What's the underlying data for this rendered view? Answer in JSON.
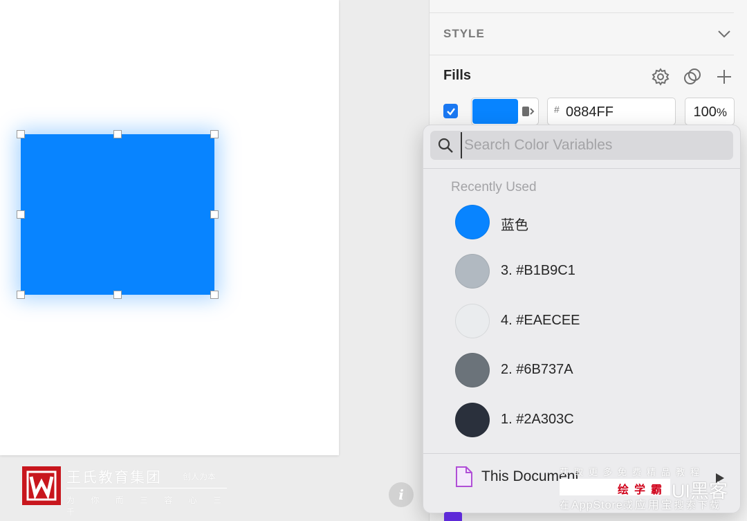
{
  "canvas": {
    "rect_color": "#0884FF",
    "brand": {
      "logo_letter": "W",
      "name": "王氏教育集团",
      "tag": "创人为本",
      "subtitle": "为 你 而 三 容 心 三 千"
    },
    "info_icon": "i"
  },
  "inspector": {
    "style_title": "STYLE",
    "fills_title": "Fills",
    "fill": {
      "enabled": true,
      "hex_prefix": "#",
      "hex": "0884FF",
      "swatch_color": "#0884FF",
      "opacity": "100",
      "opacity_unit": "%"
    },
    "icons": [
      "gear-icon",
      "blend-mode-icon",
      "add-icon",
      "chevron-down-icon"
    ]
  },
  "popover": {
    "search_placeholder": "Search Color Variables",
    "section_title": "Recently Used",
    "colors": [
      {
        "label": "蓝色",
        "color": "#0884FF"
      },
      {
        "label": "3. #B1B9C1",
        "color": "#B1B9C1"
      },
      {
        "label": "4. #EAECEE",
        "color": "#EAECEE"
      },
      {
        "label": "2. #6B737A",
        "color": "#6B737A"
      },
      {
        "label": "1. #2A303C",
        "color": "#2A303C"
      }
    ],
    "document_label": "This Document"
  },
  "watermark": {
    "top": "获取更多免费精品教程",
    "red": "绘学霸",
    "brand": "UI黑客",
    "bottom_pre": "在",
    "bottom_store": "AppStore",
    "bottom_mid": "或",
    "bottom_app": "应用宝",
    "bottom_post": "搜索下载"
  }
}
